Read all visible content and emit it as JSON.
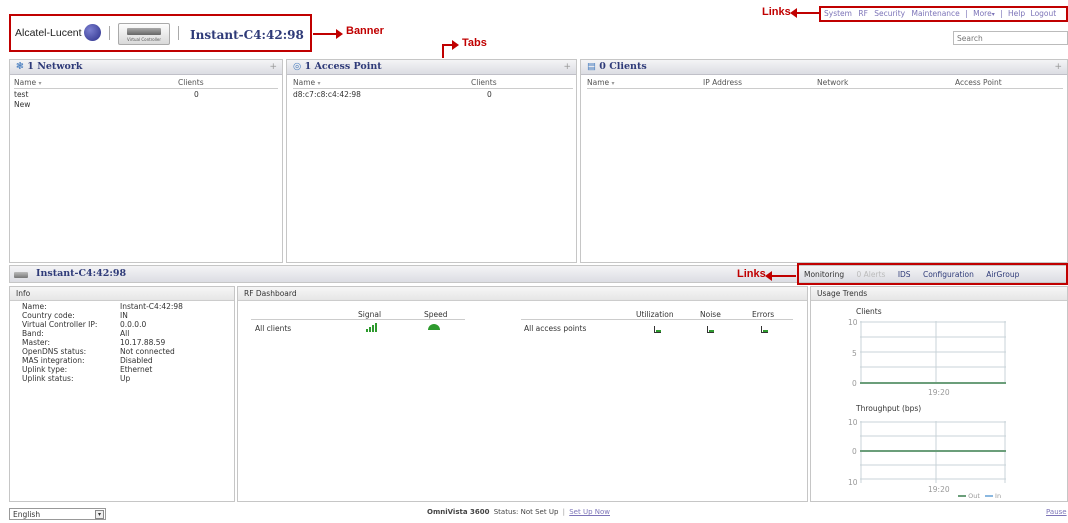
{
  "brand": {
    "logo_text": "Alcatel-Lucent",
    "device_caption": "Virtual Controller",
    "title": "Instant-C4:42:98"
  },
  "annotations": {
    "banner": "Banner",
    "tabs": "Tabs",
    "links_top": "Links",
    "links_bottom": "Links"
  },
  "top_links": [
    "System",
    "RF",
    "Security",
    "Maintenance",
    "|",
    "More",
    "|",
    "Help",
    "Logout"
  ],
  "search": {
    "placeholder": "Search"
  },
  "network_panel": {
    "title": "1 Network",
    "columns": [
      "Name",
      "Clients"
    ],
    "rows": [
      {
        "name": "test",
        "clients": "0"
      }
    ],
    "new_label": "New"
  },
  "ap_panel": {
    "title": "1 Access Point",
    "columns": [
      "Name",
      "Clients"
    ],
    "rows": [
      {
        "name": "d8:c7:c8:c4:42:98",
        "clients": "0"
      }
    ]
  },
  "clients_panel": {
    "title": "0 Clients",
    "columns": [
      "Name",
      "IP Address",
      "Network",
      "Access Point"
    ]
  },
  "lower_bar": {
    "title": "Instant-C4:42:98",
    "links": [
      "Monitoring",
      "0 Alerts",
      "IDS",
      "Configuration",
      "AirGroup"
    ]
  },
  "info": {
    "title": "Info",
    "items": [
      {
        "k": "Name:",
        "v": "Instant-C4:42:98"
      },
      {
        "k": "Country code:",
        "v": "IN"
      },
      {
        "k": "Virtual Controller IP:",
        "v": "0.0.0.0"
      },
      {
        "k": "Band:",
        "v": "All"
      },
      {
        "k": "Master:",
        "v": "10.17.88.59"
      },
      {
        "k": "OpenDNS status:",
        "v": "Not connected"
      },
      {
        "k": "MAS integration:",
        "v": "Disabled"
      },
      {
        "k": "Uplink type:",
        "v": "Ethernet"
      },
      {
        "k": "Uplink status:",
        "v": "Up"
      }
    ]
  },
  "rf": {
    "title": "RF Dashboard",
    "left_cols": [
      "Signal",
      "Speed"
    ],
    "left_row": "All clients",
    "right_cols": [
      "Utilization",
      "Noise",
      "Errors"
    ],
    "right_row": "All access points"
  },
  "usage": {
    "title": "Usage Trends",
    "clients_chart": {
      "title": "Clients",
      "yticks": [
        "10",
        "5",
        "0"
      ],
      "xlabel": "19:20"
    },
    "throughput_chart": {
      "title": "Throughput  (bps)",
      "yticks": [
        "10",
        "0",
        "10"
      ],
      "xlabel": "19:20",
      "legend": [
        "Out",
        "In"
      ]
    }
  },
  "footer": {
    "language": "English",
    "product": "OmniVista 3600",
    "status_label": "Status:",
    "status_value": "Not Set Up",
    "separator": "|",
    "setup_link": "Set Up Now",
    "pause": "Pause"
  },
  "colors": {
    "accent": "#2e3a78",
    "annotation": "#c00000",
    "link": "#7c74b8",
    "chart_line": "#6b9e7a",
    "signal": "#2e9a2e"
  }
}
